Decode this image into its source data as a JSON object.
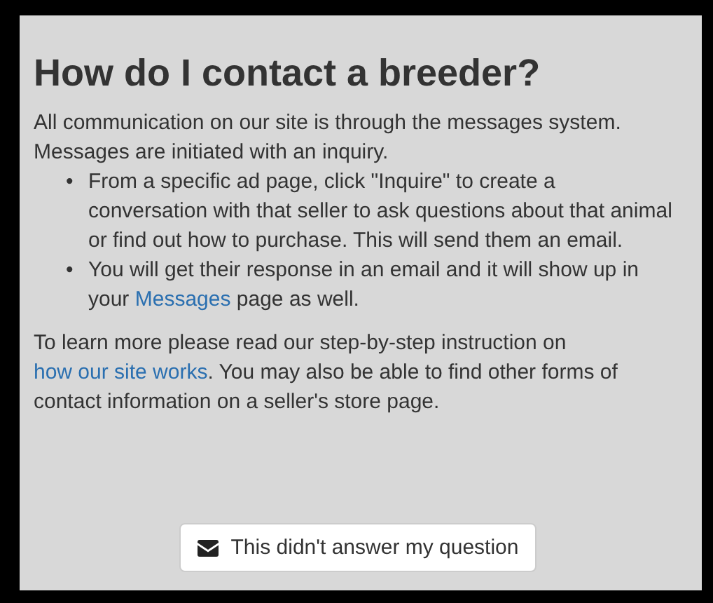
{
  "title": "How do I contact a breeder?",
  "intro": "All communication on our site is through the messages system. Messages are initiated with an inquiry.",
  "bullets": [
    {
      "marker": "•",
      "text": "From a specific ad page, click \"Inquire\" to create a conversation with that seller to ask questions about that animal or find out how to purchase. This will send them an email."
    },
    {
      "marker": "•",
      "text": "You will get their response in an email and it will show up in your ",
      "link": "Messages",
      "after": " page as well."
    }
  ],
  "outro": {
    "text": "To learn more please read our step-by-step instruction on ",
    "link": "how our site works",
    "after": ". You may also be able to find other forms of contact information on a seller's store page."
  },
  "button": "This didn't answer my question"
}
